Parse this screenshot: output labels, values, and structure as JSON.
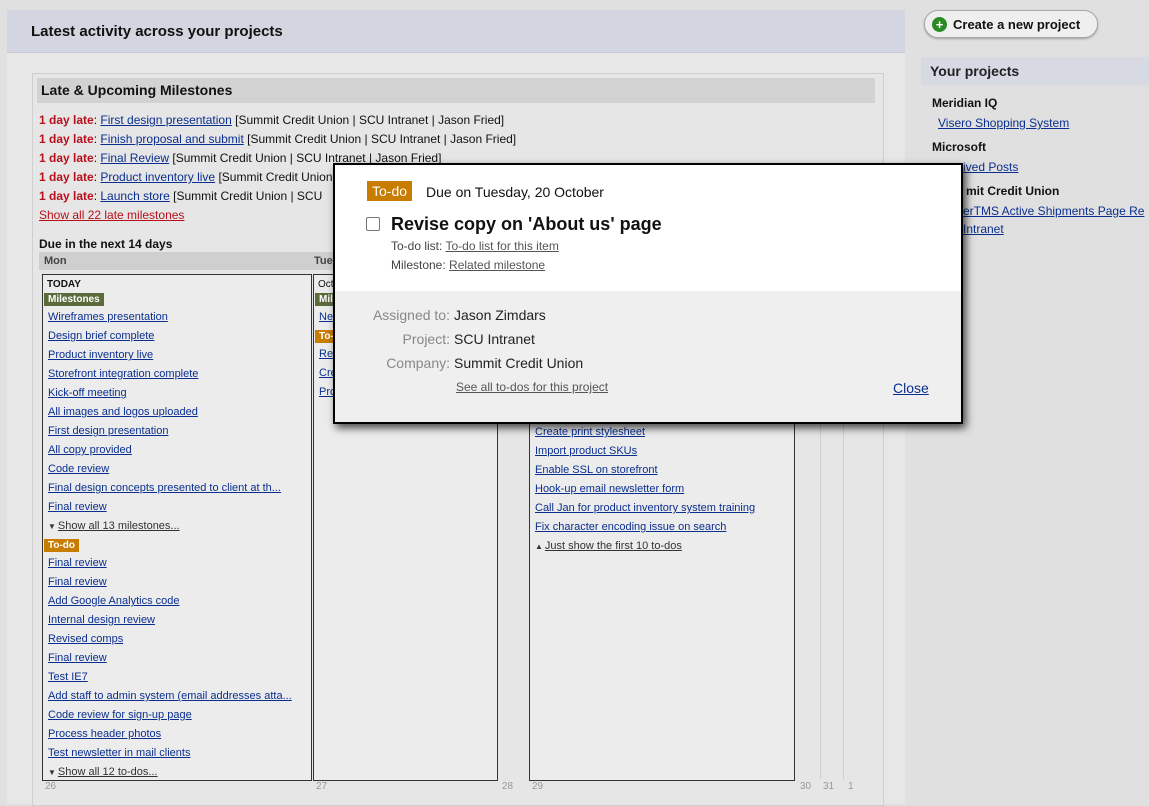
{
  "main": {
    "title": "Latest activity across your projects"
  },
  "milestones": {
    "title": "Late & Upcoming Milestones",
    "late_items": [
      {
        "late": "1 day late",
        "name": "First design presentation",
        "context": "[Summit Credit Union | SCU Intranet | Jason Fried]"
      },
      {
        "late": "1 day late",
        "name": "Finish proposal and submit",
        "context": "[Summit Credit Union | SCU Intranet | Jason Fried]"
      },
      {
        "late": "1 day late",
        "name": "Final Review",
        "context": "[Summit Credit Union | SCU Intranet | Jason Fried]"
      },
      {
        "late": "1 day late",
        "name": "Product inventory live",
        "context": "[Summit Credit Union"
      },
      {
        "late": "1 day late",
        "name": "Launch store",
        "context": "[Summit Credit Union | SCU"
      }
    ],
    "show_all_late": "Show all 22 late milestones",
    "due_title": "Due in the next 14 days",
    "day_headers": [
      "Mon",
      "Tue"
    ],
    "today_label": "TODAY",
    "mon_milestones_tag": "Milestones",
    "mon_milestones": [
      "Wireframes presentation",
      "Design brief complete",
      "Product inventory live",
      "Storefront integration complete",
      "Kick-off meeting",
      "All images and logos uploaded",
      "First design presentation",
      "All copy provided",
      "Code review",
      "Final design concepts presented to client at th...",
      "Final review"
    ],
    "mon_show_milestones": "Show all 13 milestones...",
    "todo_tag": "To-do",
    "mon_todos": [
      "Final review",
      "Final review",
      "Add Google Analytics code",
      "Internal design review",
      "Revised comps",
      "Final review",
      "Test IE7",
      "Add staff to admin system (email addresses atta...",
      "Code review for sign-up page",
      "Process header photos",
      "Test newsletter in mail clients"
    ],
    "mon_show_todos": "Show all 12 to-dos...",
    "tue_header": "Oct",
    "tue_tag_ms": "Mile",
    "tue_tag_todo": "To-",
    "tue_items": [
      "New",
      "Rev",
      "Cre",
      "Pro"
    ],
    "wed_todos": [
      "Create print stylesheet",
      "Import product SKUs",
      "Enable SSL on storefront",
      "Hook-up email newsletter form",
      "Call Jan for product inventory system training",
      "Fix character encoding issue on search"
    ],
    "wed_just_show": "Just show the first 10 to-dos",
    "day_numbers": [
      "26",
      "27",
      "28",
      "29",
      "30",
      "31",
      "1"
    ]
  },
  "sidebar": {
    "create_label": "Create a new project",
    "your_projects": "Your projects",
    "companies": [
      {
        "name": "Meridian IQ",
        "projects": [
          "Visero Shopping System"
        ]
      },
      {
        "name": "Microsoft",
        "projects": [
          "ived Posts"
        ]
      },
      {
        "name": "mit Credit Union",
        "projects": [
          "erTMS Active Shipments Page Re",
          "Intranet"
        ]
      }
    ]
  },
  "popup": {
    "tag": "To-do",
    "due": "Due on Tuesday, 20 October",
    "title": "Revise copy on 'About us' page",
    "todo_list_label": "To-do list:",
    "todo_list_link": "To-do list for this item",
    "milestone_label": "Milestone:",
    "milestone_link": "Related milestone",
    "assigned_label": "Assigned to:",
    "assigned_value": "Jason Zimdars",
    "project_label": "Project:",
    "project_value": "SCU Intranet",
    "company_label": "Company:",
    "company_value": "Summit Credit Union",
    "see_all": "See all to-dos for this project",
    "close": "Close"
  }
}
